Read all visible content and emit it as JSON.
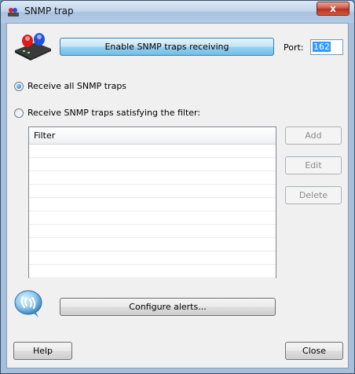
{
  "window": {
    "title": "SNMP trap",
    "close_glyph": "x"
  },
  "toolbar": {
    "enable_label": "Enable SNMP traps receiving",
    "port_label": "Port:",
    "port_value": "162"
  },
  "options": {
    "receive_all": "Receive all SNMP traps",
    "receive_filter": "Receive SNMP traps satisfying the filter:",
    "selected": "receive_all"
  },
  "filter_list": {
    "column_header": "Filter",
    "rows": []
  },
  "side_buttons": {
    "add": "Add",
    "edit": "Edit",
    "delete": "Delete"
  },
  "configure_label": "Configure alerts...",
  "footer": {
    "help": "Help",
    "close": "Close"
  },
  "colors": {
    "accent_button": "#98d1ef",
    "title_close": "#c4402e",
    "selection": "#3399ff"
  },
  "icons": {
    "title": "snmp-device-icon",
    "top": "network-device-siren-icon",
    "bottom": "alert-bubble-icon"
  }
}
